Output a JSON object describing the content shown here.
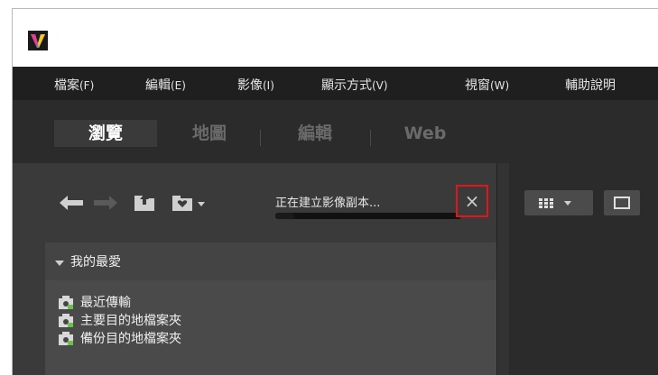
{
  "menu": [
    {
      "label": "檔案",
      "accel": "(F)"
    },
    {
      "label": "編輯",
      "accel": "(E)"
    },
    {
      "label": "影像",
      "accel": "(I)"
    },
    {
      "label": "顯示方式",
      "accel": "(V)"
    },
    {
      "label": "視窗",
      "accel": "(W)"
    },
    {
      "label": "輔助說明",
      "accel": ""
    }
  ],
  "tabs": [
    {
      "label": "瀏覽",
      "active": true
    },
    {
      "label": "地圖",
      "active": false
    },
    {
      "label": "編輯",
      "active": false
    },
    {
      "label": "Web",
      "active": false
    }
  ],
  "toolbar": {
    "back_icon": "back-arrow-icon",
    "forward_icon": "forward-arrow-icon",
    "upload_icon": "upload-folder-icon",
    "favorite_icon": "favorite-folder-icon",
    "progress_text": "正在建立影像副本...",
    "progress_percent": 10,
    "cancel_glyph": "×"
  },
  "favorites": {
    "header": "我的最愛",
    "items": [
      {
        "label": "最近傳輸"
      },
      {
        "label": "主要目的地檔案夾"
      },
      {
        "label": "備份目的地檔案夾"
      }
    ]
  },
  "colors": {
    "accent_highlight": "#e3151b",
    "dark_bg": "#1f1f1f",
    "panel_bg": "#3a3a3a"
  }
}
